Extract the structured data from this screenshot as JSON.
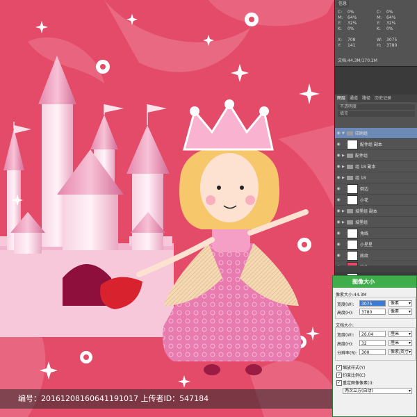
{
  "info_panel": {
    "tab_label": "信息",
    "rows": [
      [
        "C:",
        "0%",
        "C:",
        "0%"
      ],
      [
        "M:",
        "64%",
        "M:",
        "64%"
      ],
      [
        "Y:",
        "32%",
        "Y:",
        "32%"
      ],
      [
        "K:",
        "0%",
        "K:",
        "0%"
      ],
      [
        "",
        "",
        "",
        ""
      ],
      [
        "X:",
        "708",
        "W:",
        "3075"
      ],
      [
        "Y:",
        "141",
        "H:",
        "3780"
      ]
    ],
    "doc_line": "文档:44.3M/170.2M"
  },
  "layers_panel": {
    "tabs": [
      "图层",
      "通道",
      "路径",
      "历史记录"
    ],
    "mode_label": "不透明度",
    "fill_label": "填充",
    "layers": [
      {
        "name": "印刷组",
        "type": "group",
        "expanded": true,
        "selected": true
      },
      {
        "name": "配件组 副本",
        "type": "layer"
      },
      {
        "name": "配件组",
        "type": "group"
      },
      {
        "name": "组 18 副本",
        "type": "group"
      },
      {
        "name": "组 18",
        "type": "group"
      },
      {
        "name": "倒边",
        "type": "layer"
      },
      {
        "name": "小花",
        "type": "layer"
      },
      {
        "name": "城堡组 副本",
        "type": "group"
      },
      {
        "name": "城堡组",
        "type": "group"
      },
      {
        "name": "角线",
        "type": "layer"
      },
      {
        "name": "小星星",
        "type": "layer"
      },
      {
        "name": "底纹",
        "type": "layer"
      },
      {
        "name": "底色",
        "type": "layer",
        "thumb": "red"
      },
      {
        "name": "背景",
        "type": "layer"
      }
    ]
  },
  "image_size_dialog": {
    "title": "图像大小",
    "pixel_size_label": "像素大小:44.3M",
    "width_label": "宽度(W):",
    "width_value": "3075",
    "height_label": "高度(H):",
    "height_value": "3780",
    "pixel_unit": "像素",
    "doc_size_label": "文档大小:",
    "doc_width_value": "26.04",
    "doc_height_value": "32",
    "unit_cm": "厘米",
    "resolution_label": "分辨率(R):",
    "resolution_value": "300",
    "resolution_unit": "像素/英寸",
    "check_scale_styles": "缩放样式(Y)",
    "check_constrain": "约束比例(C)",
    "check_resample": "重定图像像素(I):",
    "resample_method": "两次立方(自动)"
  },
  "watermark": {
    "text": "编号：20161208160641191017 上传者ID：547184"
  },
  "colors": {
    "background": "#e34b69",
    "accent": "#3fae4a",
    "layer_selected": "#6d89b5"
  }
}
